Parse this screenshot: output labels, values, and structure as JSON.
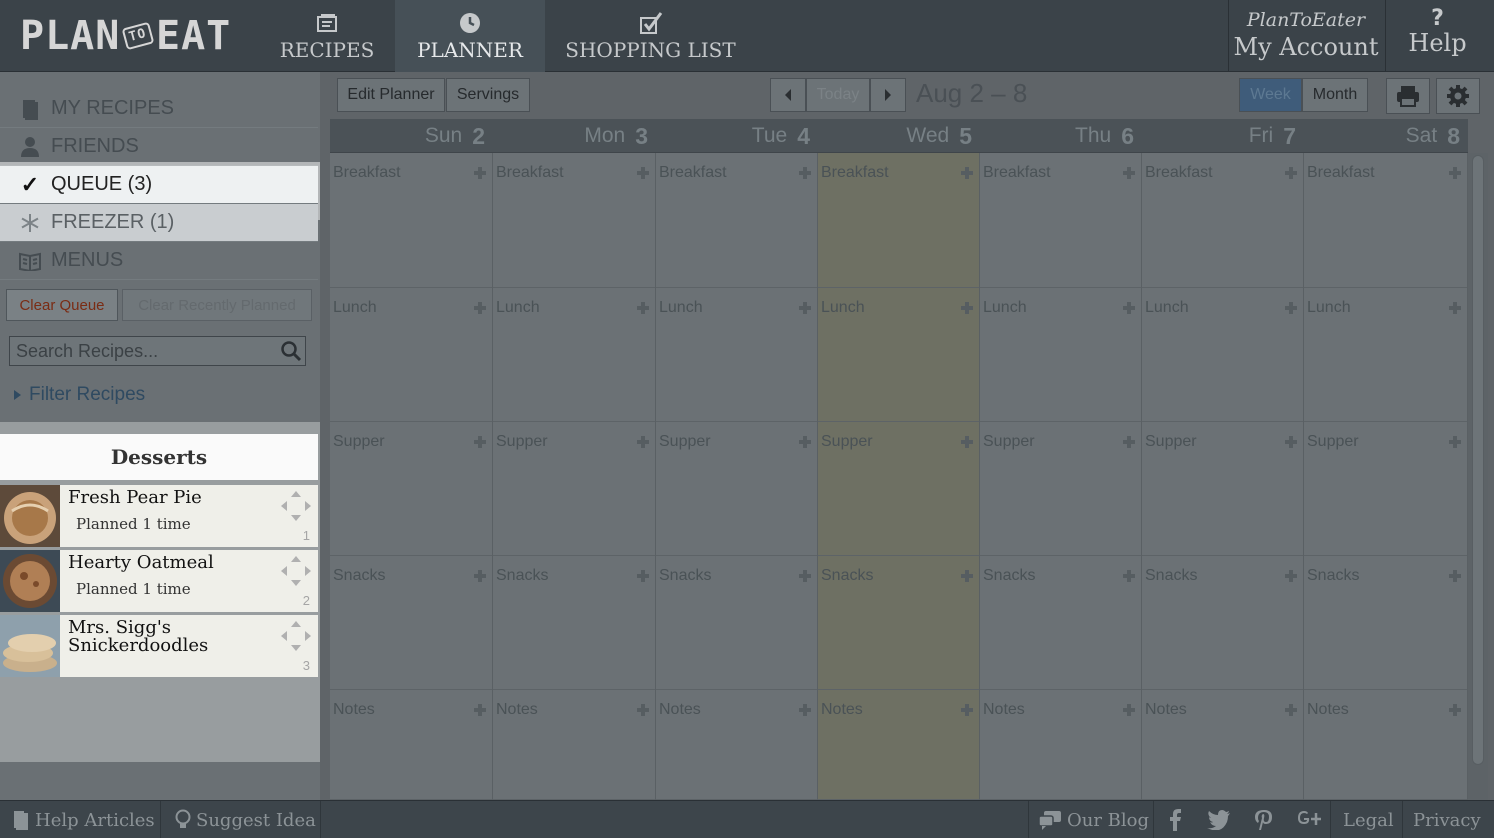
{
  "logo": {
    "left": "PLAN",
    "to": "TO",
    "right": "EAT"
  },
  "nav": {
    "recipes": "RECIPES",
    "planner": "PLANNER",
    "shopping": "SHOPPING LIST"
  },
  "account": {
    "brand": "PlanToEater",
    "label": "My Account"
  },
  "help": {
    "icon": "?",
    "label": "Help"
  },
  "sidebar": {
    "items": [
      {
        "label": "MY RECIPES",
        "icon": "book-icon"
      },
      {
        "label": "FRIENDS",
        "icon": "person-icon"
      },
      {
        "label": "QUEUE (3)",
        "icon": "checkmark-icon"
      },
      {
        "label": "FREEZER (1)",
        "icon": "snowflake-icon"
      },
      {
        "label": "MENUS",
        "icon": "menus-icon"
      }
    ],
    "clear_queue": "Clear Queue",
    "clear_recent": "Clear Recently Planned",
    "search_placeholder": "Search Recipes...",
    "filter": "Filter Recipes",
    "section_title": "Desserts",
    "recipes": [
      {
        "name": "Fresh Pear Pie",
        "sub": "Planned 1 time",
        "num": "1"
      },
      {
        "name": "Hearty Oatmeal",
        "sub": "Planned 1 time",
        "num": "2"
      },
      {
        "name": "Mrs. Sigg's Snickerdoodles",
        "sub": "",
        "num": "3"
      }
    ]
  },
  "toolbar": {
    "edit_planner": "Edit Planner",
    "servings": "Servings",
    "today": "Today",
    "date_range": "Aug 2 – 8",
    "week": "Week",
    "month": "Month"
  },
  "days": [
    {
      "name": "Sun",
      "num": "2"
    },
    {
      "name": "Mon",
      "num": "3"
    },
    {
      "name": "Tue",
      "num": "4"
    },
    {
      "name": "Wed",
      "num": "5"
    },
    {
      "name": "Thu",
      "num": "6"
    },
    {
      "name": "Fri",
      "num": "7"
    },
    {
      "name": "Sat",
      "num": "8"
    }
  ],
  "meals": [
    "Breakfast",
    "Lunch",
    "Supper",
    "Snacks",
    "Notes"
  ],
  "footer": {
    "help_articles": "Help Articles",
    "suggest": "Suggest Idea",
    "blog": "Our Blog",
    "legal": "Legal",
    "privacy": "Privacy"
  }
}
